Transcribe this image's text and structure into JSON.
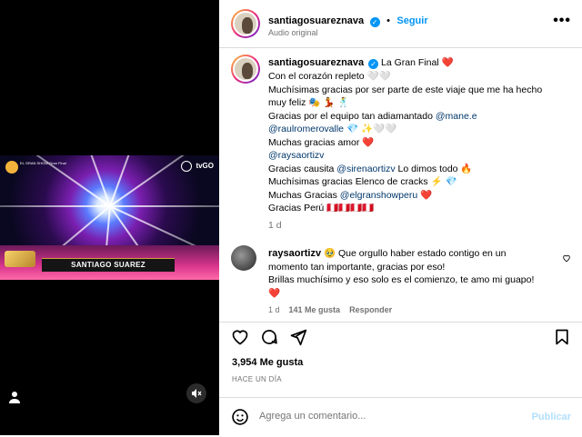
{
  "video": {
    "lower_third": "SANTIAGO SUAREZ",
    "show_logo_text": "EL GRAN SHOW\nGran Final",
    "channel_logo": "tvGO",
    "icons": {
      "user": "user-icon",
      "mute": "muted-speaker-icon"
    }
  },
  "header": {
    "username": "santiagosuareznava",
    "follow_label": "Seguir",
    "separator": "•",
    "audio": "Audio original",
    "more_label": "•••"
  },
  "caption": {
    "username": "santiagosuareznava",
    "title": "La Gran Final",
    "emoji_heart": "❤️",
    "lines": [
      "Con el corazón repleto 🤍🤍",
      "Muchísimas gracias por ser parte de este viaje que me ha hecho",
      "muy feliz 🎭 💃 🕺",
      "Gracias por el equipo tan adiamantado",
      "Muchas gracias amor ❤️",
      "Gracias causita",
      "Muchísimas gracias Elenco de cracks ⚡ 💎",
      "Muchas Gracias",
      "Gracias Perú 🇵🇪🇵🇪🇵🇪🇵🇪"
    ],
    "mentions": {
      "mane": "@mane.e",
      "raul": "@raulromerovalle",
      "raul_suffix": " 💎 ✨🤍🤍",
      "rays": "@raysaortizv",
      "sirena": "@sirenaortizv",
      "sirena_suffix": " Lo dimos todo 🔥",
      "elgran": "@elgranshowperu",
      "elgran_suffix": " ❤️"
    },
    "time": "1 d"
  },
  "reply": {
    "username": "raysaortizv",
    "lines": [
      "🥹 Que orgullo haber estado contigo en un",
      "momento tan importante, gracias por eso!",
      "Brillas muchísimo y eso solo es el comienzo, te amo mi guapo!",
      "❤️"
    ],
    "time": "1 d",
    "likes": "141 Me gusta",
    "reply_label": "Responder"
  },
  "actions": {
    "likes_count": "3,954 Me gusta",
    "time_ago": "HACE UN DÍA",
    "comment_placeholder": "Agrega un comentario...",
    "publish_label": "Publicar",
    "icons": [
      "heart-icon",
      "comment-icon",
      "share-icon",
      "bookmark-icon",
      "emoji-icon"
    ]
  },
  "colors": {
    "link": "#00376b",
    "accent": "#0095f6",
    "muted": "#737373",
    "publish_disabled": "#b2dffc"
  }
}
